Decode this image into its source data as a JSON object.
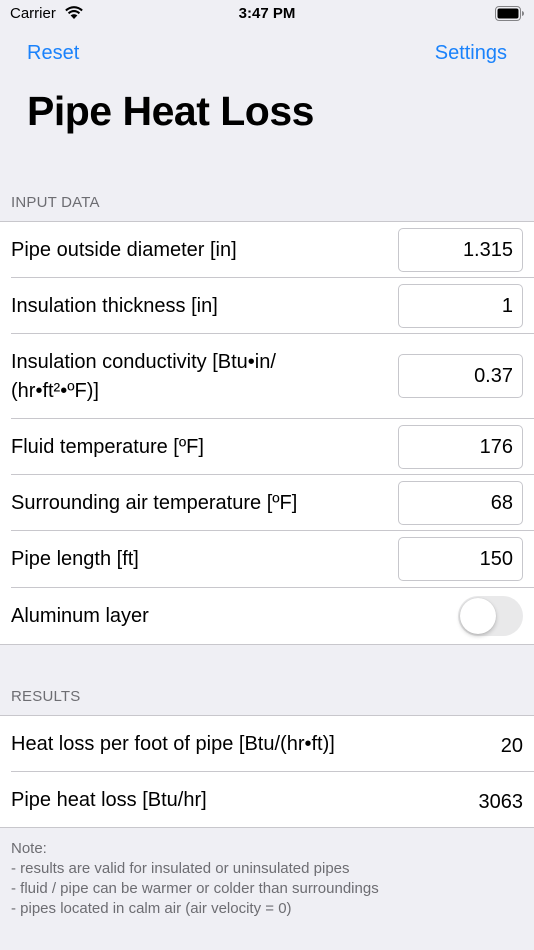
{
  "status_bar": {
    "carrier": "Carrier",
    "time": "3:47 PM",
    "icons": [
      "wifi-icon",
      "battery-icon"
    ]
  },
  "nav": {
    "reset_label": "Reset",
    "settings_label": "Settings"
  },
  "title": "Pipe Heat Loss",
  "input_section": {
    "header": "INPUT DATA",
    "rows": [
      {
        "label": "Pipe outside diameter [in]",
        "value": "1.315"
      },
      {
        "label": "Insulation thickness [in]",
        "value": "1"
      },
      {
        "label_line1": "Insulation conductivity [Btu•in/",
        "label_line2": "(hr•ft²•ºF)]",
        "value": "0.37"
      },
      {
        "label": "Fluid temperature [ºF]",
        "value": "176"
      },
      {
        "label": "Surrounding air temperature [ºF]",
        "value": "68"
      },
      {
        "label": "Pipe length [ft]",
        "value": "150"
      }
    ],
    "toggle_row": {
      "label": "Aluminum layer",
      "on": false
    }
  },
  "results_section": {
    "header": "RESULTS",
    "rows": [
      {
        "label": "Heat loss per foot of pipe [Btu/(hr•ft)]",
        "value": "20"
      },
      {
        "label": "Pipe heat loss [Btu/hr]",
        "value": "3063"
      }
    ]
  },
  "note": {
    "title": "Note:",
    "lines": [
      "- results are valid for insulated or uninsulated pipes",
      "- fluid / pipe can be warmer or colder than surroundings",
      "- pipes located in calm air (air velocity = 0)"
    ]
  },
  "colors": {
    "accent": "#1a82fb",
    "background": "#efeff4",
    "secondary_text": "#6d6d72",
    "separator": "#c8c7cc",
    "toggle_off": "#e9e9ea"
  }
}
